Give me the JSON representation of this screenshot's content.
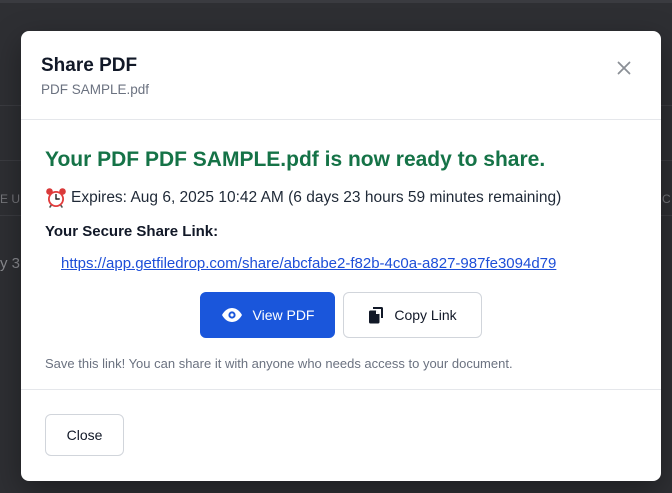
{
  "background": {
    "frag_left_header": "E U",
    "frag_right_header": "C",
    "frag_left_row": "y 3"
  },
  "modal": {
    "title": "Share PDF",
    "subtitle": "PDF SAMPLE.pdf",
    "ready_message": "Your PDF PDF SAMPLE.pdf is now ready to share.",
    "expires_text": "Expires: Aug 6, 2025 10:42 AM (6 days 23 hours 59 minutes remaining)",
    "link_label": "Your Secure Share Link:",
    "share_link": "https://app.getfiledrop.com/share/abcfabe2-f82b-4c0a-a827-987fe3094d79",
    "view_button_label": "View PDF",
    "copy_button_label": "Copy Link",
    "help_text": "Save this link! You can share it with anyone who needs access to your document.",
    "close_button_label": "Close"
  },
  "icons": {
    "close": "close-icon",
    "alarm": "alarm-clock-icon",
    "view": "eye-icon",
    "copy": "copy-icon"
  },
  "colors": {
    "success": "#157347",
    "primary": "#1a56db",
    "link": "#1d4ed8",
    "backdrop": "#2e2f33"
  }
}
